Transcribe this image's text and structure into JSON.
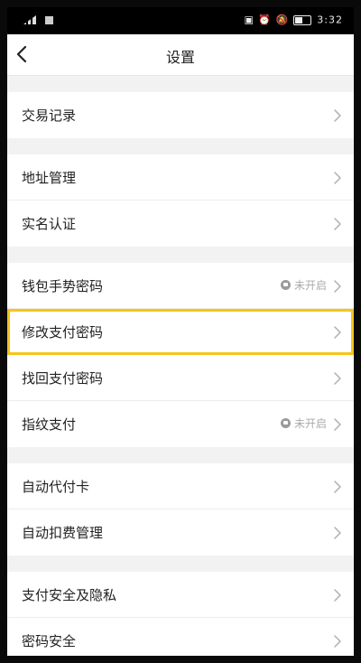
{
  "status_bar": {
    "time": "3:32",
    "battery_level": 0.45
  },
  "nav": {
    "title": "设置",
    "back_icon": "chevron-left-icon"
  },
  "colors": {
    "highlight": "#f5c518",
    "background": "#f2f2f2"
  },
  "groups": [
    {
      "items": [
        {
          "label": "交易记录"
        }
      ]
    },
    {
      "items": [
        {
          "label": "地址管理"
        },
        {
          "label": "实名认证"
        }
      ]
    },
    {
      "items": [
        {
          "label": "钱包手势密码",
          "status": "未开启"
        },
        {
          "label": "修改支付密码",
          "highlighted": true
        },
        {
          "label": "找回支付密码"
        },
        {
          "label": "指纹支付",
          "status": "未开启"
        }
      ]
    },
    {
      "items": [
        {
          "label": "自动代付卡"
        },
        {
          "label": "自动扣费管理"
        }
      ]
    },
    {
      "items": [
        {
          "label": "支付安全及隐私"
        },
        {
          "label": "密码安全"
        }
      ]
    }
  ]
}
